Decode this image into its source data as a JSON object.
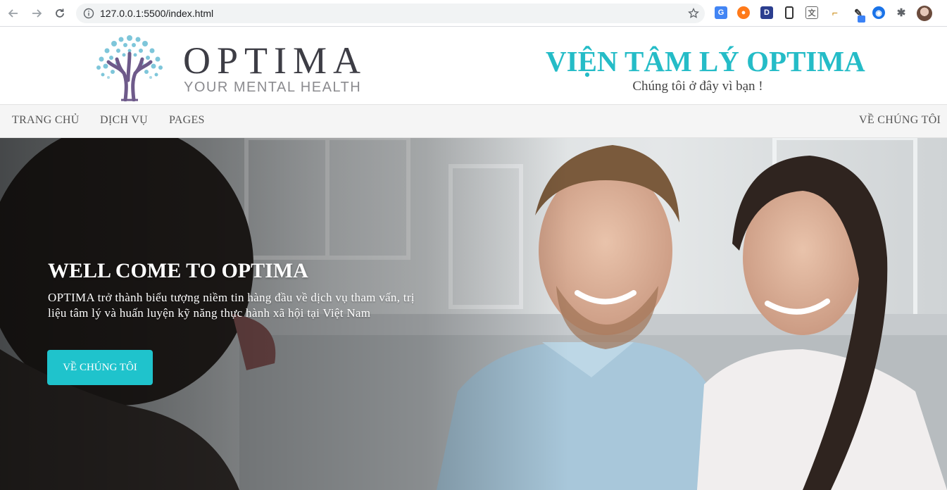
{
  "browser": {
    "url": "127.0.0.1:5500/index.html",
    "icons": [
      "back-icon",
      "forward-icon",
      "reload-icon",
      "info-icon",
      "bookmark-star-icon",
      "extensions-icon",
      "profile-avatar"
    ]
  },
  "header": {
    "logo_word": "OPTIMA",
    "logo_tagline": "YOUR MENTAL HEALTH",
    "brand_title": "VIỆN TÂM LÝ OPTIMA",
    "brand_subtitle": "Chúng tôi ở đây vì bạn !"
  },
  "nav": {
    "items": [
      {
        "label": "TRANG CHỦ"
      },
      {
        "label": "DỊCH VỤ"
      },
      {
        "label": "PAGES"
      }
    ],
    "right_item": {
      "label": "VỀ CHÚNG TÔI"
    }
  },
  "hero": {
    "title": "WELL COME TO OPTIMA",
    "description": "OPTIMA trở thành biểu tượng niềm tin hàng đầu về dịch vụ tham vấn, trị liệu tâm lý và huấn luyện kỹ năng thực hành xã hội tại Việt Nam",
    "button_label": "VỀ CHÚNG TÔI"
  },
  "colors": {
    "accent": "#25bcc7",
    "button": "#1fc3cc",
    "logo_text": "#3d3d45",
    "nav_bg": "#f5f5f5"
  }
}
